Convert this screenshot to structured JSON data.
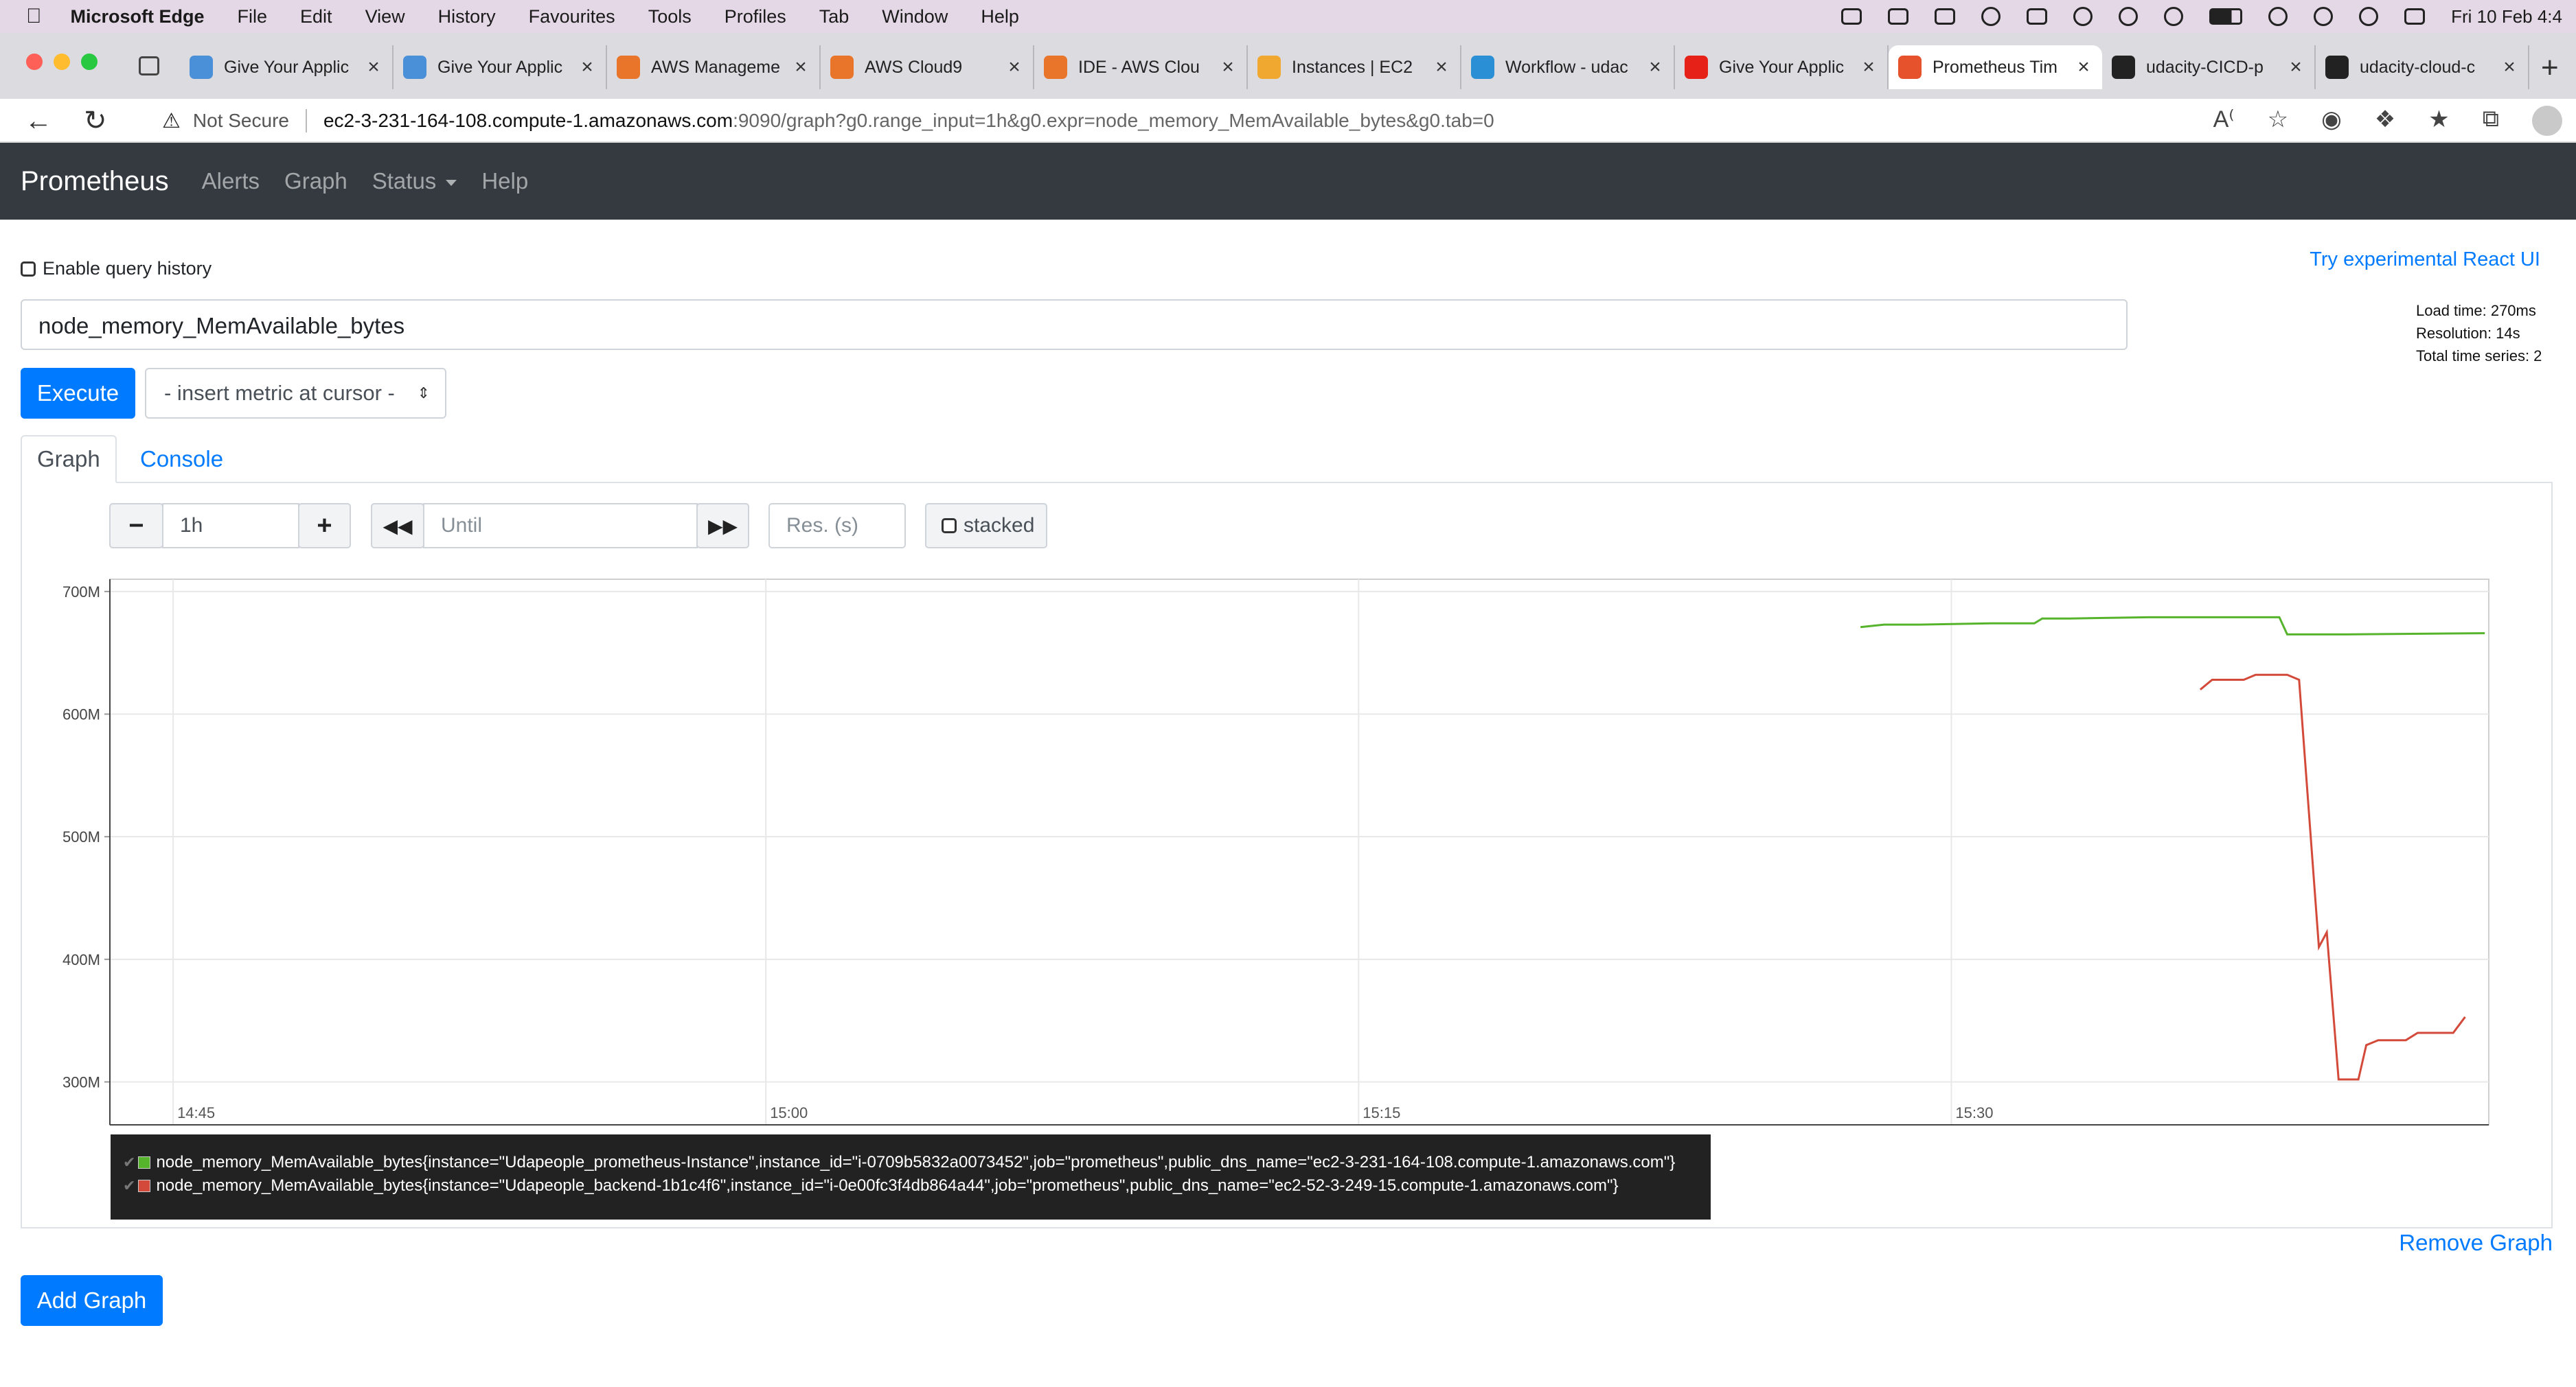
{
  "menubar": {
    "app": "Microsoft Edge",
    "items": [
      "File",
      "Edit",
      "View",
      "History",
      "Favourites",
      "Tools",
      "Profiles",
      "Tab",
      "Window",
      "Help"
    ],
    "clock": "Fri 10 Feb  4:4"
  },
  "tabs": [
    {
      "title": "Give Your Applic",
      "favicon_color": "#4a90d9"
    },
    {
      "title": "Give Your Applic",
      "favicon_color": "#4a90d9"
    },
    {
      "title": "AWS Manageme",
      "favicon_color": "#e8752a"
    },
    {
      "title": "AWS Cloud9",
      "favicon_color": "#e8752a"
    },
    {
      "title": "IDE - AWS Clou",
      "favicon_color": "#e8752a"
    },
    {
      "title": "Instances | EC2",
      "favicon_color": "#f0a830"
    },
    {
      "title": "Workflow - udac",
      "favicon_color": "#2b8fd6"
    },
    {
      "title": "Give Your Applic",
      "favicon_color": "#e62117"
    },
    {
      "title": "Prometheus Tim",
      "favicon_color": "#e6522c"
    },
    {
      "title": "udacity-CICD-p",
      "favicon_color": "#222222"
    },
    {
      "title": "udacity-cloud-c",
      "favicon_color": "#222222"
    }
  ],
  "address": {
    "not_secure": "Not Secure",
    "host": "ec2-3-231-164-108.compute-1.amazonaws.com",
    "rest": ":9090/graph?g0.range_input=1h&g0.expr=node_memory_MemAvailable_bytes&g0.tab=0"
  },
  "nav": {
    "brand": "Prometheus",
    "alerts": "Alerts",
    "graph": "Graph",
    "status": "Status",
    "help": "Help"
  },
  "page": {
    "enable_history": "Enable query history",
    "react_link": "Try experimental React UI",
    "load_time": "Load time: 270ms",
    "resolution": "Resolution: 14s",
    "total_series": "Total time series: 2",
    "expression": "node_memory_MemAvailable_bytes",
    "execute": "Execute",
    "insert_metric": "- insert metric at cursor -",
    "tab_graph": "Graph",
    "tab_console": "Console",
    "range_value": "1h",
    "until_placeholder": "Until",
    "res_placeholder": "Res. (s)",
    "stacked": "stacked",
    "remove_graph": "Remove Graph",
    "add_graph": "Add Graph"
  },
  "chart_data": {
    "type": "line",
    "x_tick_labels": [
      "14:45",
      "15:00",
      "15:15",
      "15:30"
    ],
    "y_tick_labels": [
      "700M",
      "600M",
      "500M",
      "400M",
      "300M"
    ],
    "x_domain_minutes": [
      -1.6,
      58.6
    ],
    "ylim_millions": [
      265,
      710
    ],
    "series": [
      {
        "name": "node_memory_MemAvailable_bytes{instance=\"Udapeople_prometheus-Instance\",instance_id=\"i-0709b5832a0073452\",job=\"prometheus\",public_dns_name=\"ec2-3-231-164-108.compute-1.amazonaws.com\"}",
        "color": "#56b42c",
        "x_minutes": [
          42.7,
          43.3,
          44.2,
          46,
          47.1,
          47.3,
          48,
          50,
          52,
          53.3,
          53.5,
          55,
          58.5
        ],
        "values": [
          671,
          673,
          673,
          674,
          674,
          678,
          678,
          679,
          679,
          679,
          665,
          665,
          666
        ]
      },
      {
        "name": "node_memory_MemAvailable_bytes{instance=\"Udapeople_backend-1b1c4f6\",instance_id=\"i-0e00fc3f4db864a44\",job=\"prometheus\",public_dns_name=\"ec2-52-3-249-15.compute-1.amazonaws.com\"}",
        "color": "#d34a3a",
        "x_minutes": [
          51.3,
          51.6,
          52.4,
          52.7,
          53.5,
          53.8,
          54.3,
          54.5,
          54.8,
          55.3,
          55.5,
          55.8,
          56.5,
          56.8,
          57.7,
          58
        ],
        "values": [
          620,
          628,
          628,
          632,
          632,
          628,
          410,
          422,
          302,
          302,
          330,
          334,
          334,
          340,
          340,
          353
        ]
      }
    ]
  }
}
